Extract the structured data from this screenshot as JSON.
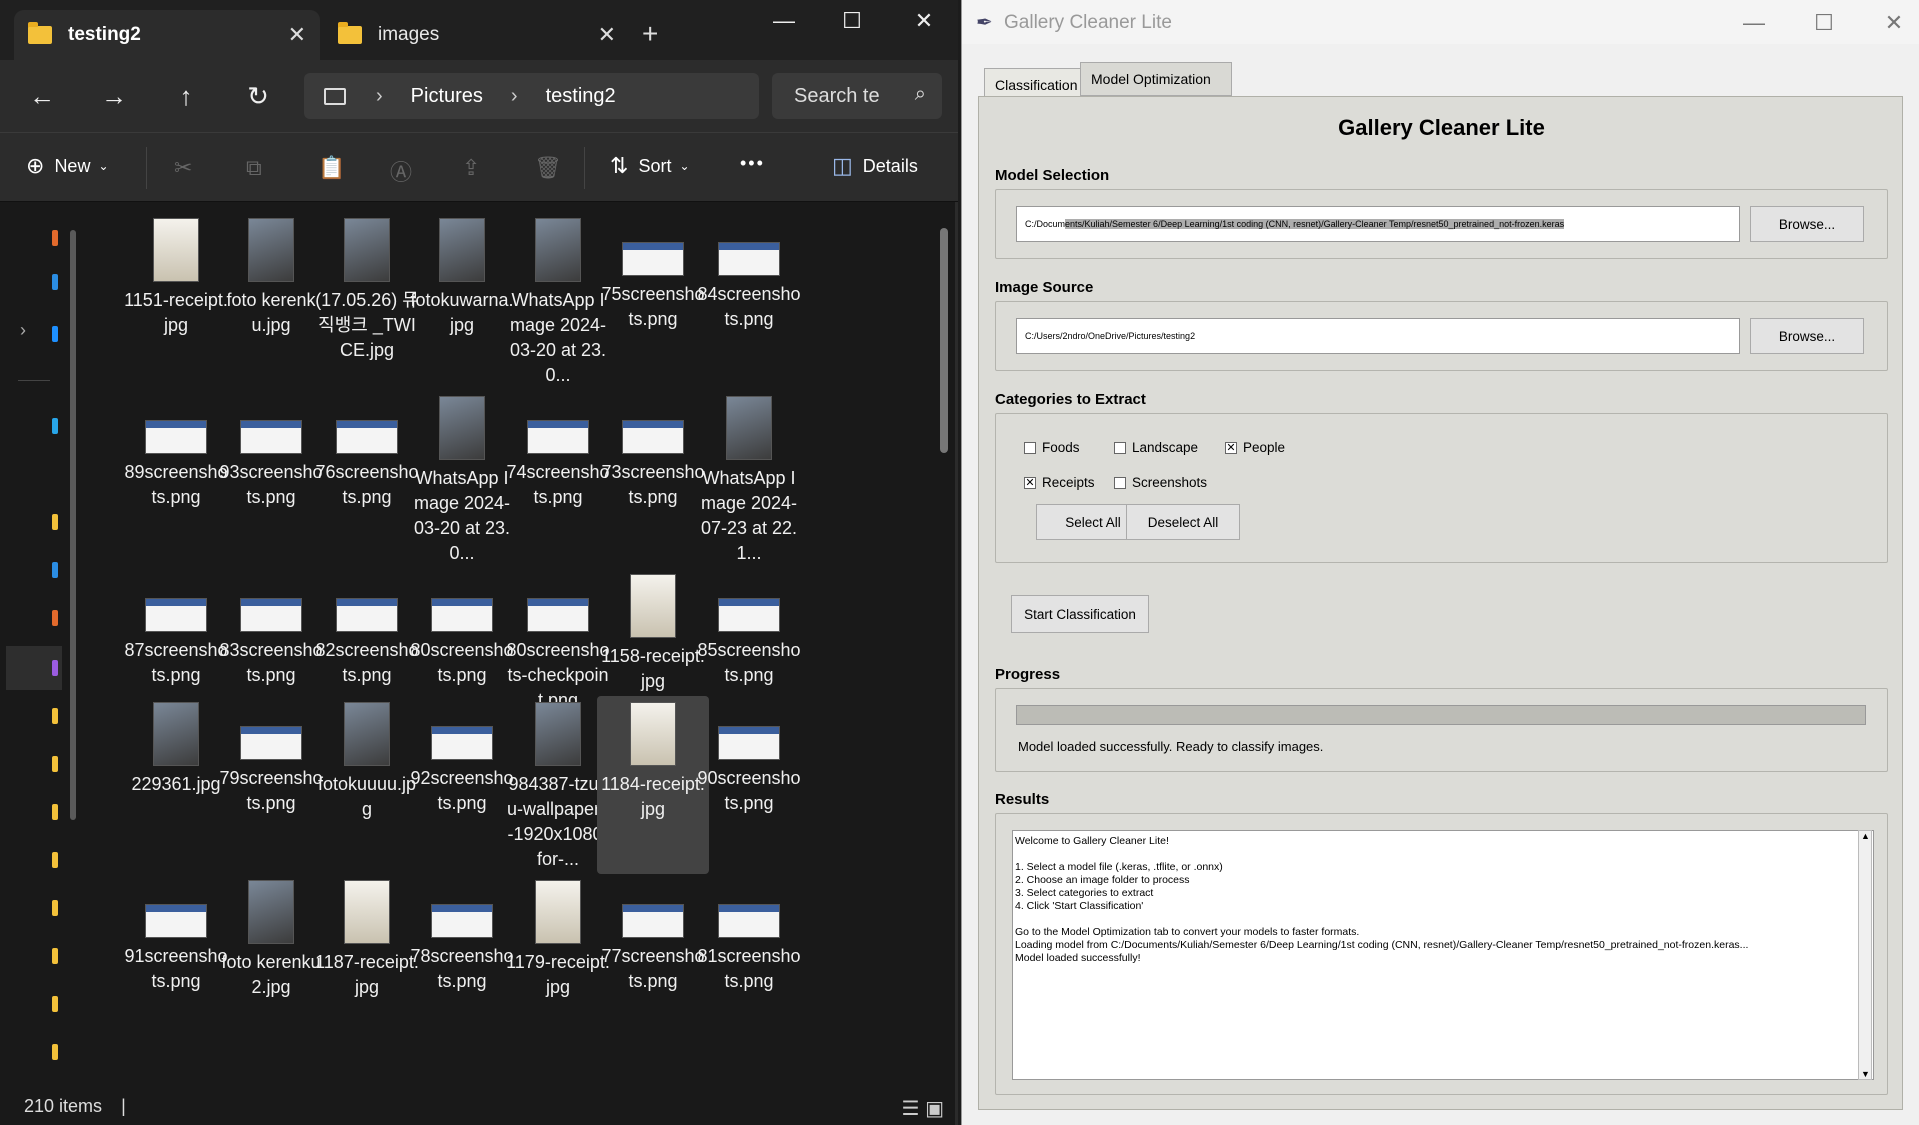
{
  "explorer": {
    "tabs": [
      {
        "label": "testing2",
        "active": true
      },
      {
        "label": "images",
        "active": false
      }
    ],
    "breadcrumb": [
      "Pictures",
      "testing2"
    ],
    "search_placeholder": "Search te",
    "toolbar": {
      "new_label": "New",
      "sort_label": "Sort",
      "details_label": "Details",
      "more_label": "•••"
    },
    "files": [
      {
        "name": "1151-receipt.jpg",
        "kind": "receipt"
      },
      {
        "name": "foto kerenku.jpg",
        "kind": "photo"
      },
      {
        "name": "(17.05.26) 뮤직뱅크 _TWICE.jpg",
        "kind": "photo"
      },
      {
        "name": "fotokuwarna.jpg",
        "kind": "photo"
      },
      {
        "name": "WhatsApp Image 2024-03-20 at 23.0...",
        "kind": "photo"
      },
      {
        "name": "75screenshots.png",
        "kind": "shot"
      },
      {
        "name": "84screenshots.png",
        "kind": "shot"
      },
      {
        "name": "89screenshots.png",
        "kind": "shot"
      },
      {
        "name": "93screenshots.png",
        "kind": "shot"
      },
      {
        "name": "76screenshots.png",
        "kind": "shot"
      },
      {
        "name": "WhatsApp Image 2024-03-20 at 23.0...",
        "kind": "photo"
      },
      {
        "name": "74screenshots.png",
        "kind": "shot"
      },
      {
        "name": "73screenshots.png",
        "kind": "shot"
      },
      {
        "name": "WhatsApp Image 2024-07-23 at 22.1...",
        "kind": "photo"
      },
      {
        "name": "87screenshots.png",
        "kind": "shot"
      },
      {
        "name": "83screenshots.png",
        "kind": "shot"
      },
      {
        "name": "82screenshots.png",
        "kind": "shot"
      },
      {
        "name": "80screenshots.png",
        "kind": "shot"
      },
      {
        "name": "80screenshots-checkpoint.png",
        "kind": "shot"
      },
      {
        "name": "1158-receipt.jpg",
        "kind": "receipt"
      },
      {
        "name": "85screenshots.png",
        "kind": "shot"
      },
      {
        "name": "229361.jpg",
        "kind": "photo"
      },
      {
        "name": "79screenshots.png",
        "kind": "shot"
      },
      {
        "name": "fotokuuuu.jpg",
        "kind": "photo"
      },
      {
        "name": "92screenshots.png",
        "kind": "shot"
      },
      {
        "name": "984387-tzuyu-wallpapers-1920x1080-for-...",
        "kind": "photo"
      },
      {
        "name": "1184-receipt.jpg",
        "kind": "receipt",
        "selected": true
      },
      {
        "name": "90screenshots.png",
        "kind": "shot"
      },
      {
        "name": "91screenshots.png",
        "kind": "shot"
      },
      {
        "name": "foto kerenku 2.jpg",
        "kind": "photo"
      },
      {
        "name": "1187-receipt.jpg",
        "kind": "receipt"
      },
      {
        "name": "78screenshots.png",
        "kind": "shot"
      },
      {
        "name": "1179-receipt.jpg",
        "kind": "receipt"
      },
      {
        "name": "77screenshots.png",
        "kind": "shot"
      },
      {
        "name": "81screenshots.png",
        "kind": "shot"
      }
    ],
    "status_text": "210 items"
  },
  "gallery": {
    "window_title": "Gallery Cleaner Lite",
    "tabs": {
      "classification": "Classification",
      "optimization": "Model Optimization"
    },
    "app_heading": "Gallery Cleaner Lite",
    "model_section_label": "Model Selection",
    "model_path_plain": "C:/Docum",
    "model_path_selected": "ents/Kuliah/Semester 6/Deep Learning/1st coding (CNN, resnet)/Gallery-Cleaner Temp/resnet50_pretrained_not-frozen.keras",
    "browse_label": "Browse...",
    "image_section_label": "Image Source",
    "image_path": "C:/Users/2ndro/OneDrive/Pictures/testing2",
    "categories_label": "Categories to Extract",
    "categories": [
      {
        "label": "Foods",
        "checked": false
      },
      {
        "label": "Landscape",
        "checked": false
      },
      {
        "label": "People",
        "checked": true
      },
      {
        "label": "Receipts",
        "checked": true
      },
      {
        "label": "Screenshots",
        "checked": false
      }
    ],
    "select_all_label": "Select All",
    "deselect_all_label": "Deselect All",
    "start_label": "Start Classification",
    "progress_label": "Progress",
    "progress_value": 0,
    "progress_status": "Model loaded successfully. Ready to classify images.",
    "results_label": "Results",
    "results_lines": [
      "Welcome to Gallery Cleaner Lite!",
      "",
      "1. Select a model file (.keras, .tflite, or .onnx)",
      "2. Choose an image folder to process",
      "3. Select categories to extract",
      "4. Click 'Start Classification'",
      "",
      "Go to the Model Optimization tab to convert your models to faster formats.",
      "Loading model from C:/Documents/Kuliah/Semester 6/Deep Learning/1st coding (CNN, resnet)/Gallery-Cleaner Temp/resnet50_pretrained_not-frozen.keras...",
      "Model loaded successfully!"
    ]
  }
}
